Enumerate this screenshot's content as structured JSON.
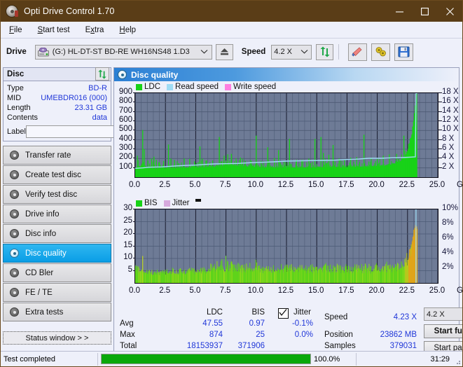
{
  "window": {
    "title": "Opti Drive Control 1.70",
    "icon": "disc-icon",
    "minimize": "minimize",
    "maximize": "maximize",
    "close": "close"
  },
  "menu": [
    {
      "label": "File",
      "accel": "F"
    },
    {
      "label": "Start test",
      "accel": "S"
    },
    {
      "label": "Extra",
      "accel": "x"
    },
    {
      "label": "Help",
      "accel": "H"
    }
  ],
  "toolbar": {
    "drive_label": "Drive",
    "drive_value": "(G:)  HL-DT-ST BD-RE  WH16NS48 1.D3",
    "eject_label": "eject",
    "speed_label": "Speed",
    "speed_value": "4.2 X",
    "refresh_label": "refresh",
    "erase_label": "erase",
    "bitsetting_label": "bitsetting",
    "save_label": "save"
  },
  "disc": {
    "header": "Disc",
    "refresh_label": "refresh",
    "rows": [
      {
        "key": "Type",
        "value": "BD-R"
      },
      {
        "key": "MID",
        "value": "UMEBDR016 (000)"
      },
      {
        "key": "Length",
        "value": "23.31 GB"
      },
      {
        "key": "Contents",
        "value": "data"
      }
    ],
    "label_key": "Label",
    "label_value": "",
    "label_placeholder": ""
  },
  "nav": {
    "items": [
      {
        "label": "Transfer rate",
        "selected": false
      },
      {
        "label": "Create test disc",
        "selected": false
      },
      {
        "label": "Verify test disc",
        "selected": false
      },
      {
        "label": "Drive info",
        "selected": false
      },
      {
        "label": "Disc info",
        "selected": false
      },
      {
        "label": "Disc quality",
        "selected": true
      },
      {
        "label": "CD Bler",
        "selected": false
      },
      {
        "label": "FE / TE",
        "selected": false
      },
      {
        "label": "Extra tests",
        "selected": false
      }
    ],
    "status_window": "Status window > >"
  },
  "panel": {
    "title": "Disc quality"
  },
  "stats": {
    "col_headers": [
      "LDC",
      "BIS"
    ],
    "jitter_label": "Jitter",
    "jitter_checked": true,
    "rows": [
      {
        "name": "Avg",
        "ldc": "47.55",
        "bis": "0.97",
        "jitter": "-0.1%"
      },
      {
        "name": "Max",
        "ldc": "874",
        "bis": "25",
        "jitter": "0.0%"
      },
      {
        "name": "Total",
        "ldc": "18153937",
        "bis": "371906",
        "jitter": ""
      }
    ],
    "speed_key": "Speed",
    "speed_value": "4.23 X",
    "position_key": "Position",
    "position_value": "23862 MB",
    "samples_key": "Samples",
    "samples_value": "379031",
    "speed_select": "4.2 X",
    "start_full": "Start full",
    "start_part": "Start part"
  },
  "statusbar": {
    "message": "Test completed",
    "progress_text": "100.0%",
    "progress_value": 100,
    "elapsed": "31:29"
  },
  "colors": {
    "ldc": "#18d218",
    "bis": "#5fd41a",
    "read_speed": "#9fdcf5",
    "write_speed": "#ff7fe0",
    "jitter": "#d7a9dd",
    "plot_bg": "#6e7b96",
    "accent": "#2037d8",
    "progress": "#0aa80a",
    "titlebar": "#5a3d17"
  },
  "chart_data": [
    {
      "type": "area",
      "id": "ldc-chart",
      "title": "Disc quality",
      "legend": [
        {
          "name": "LDC",
          "color": "#18d218"
        },
        {
          "name": "Read speed",
          "color": "#9fdcf5"
        },
        {
          "name": "Write speed",
          "color": "#ff7fe0"
        }
      ],
      "legend_position": "top-left",
      "grid": true,
      "xlabel": "GB",
      "xlim": [
        0,
        25
      ],
      "xticks": [
        "0.0",
        "2.5",
        "5.0",
        "7.5",
        "10.0",
        "12.5",
        "15.0",
        "17.5",
        "20.0",
        "22.5",
        "25.0"
      ],
      "ylabel": "",
      "ylim": [
        0,
        900
      ],
      "yticks": [
        100,
        200,
        300,
        400,
        500,
        600,
        700,
        800,
        900
      ],
      "y2label": "",
      "y2lim": [
        0,
        18
      ],
      "y2ticks": [
        "2 X",
        "4 X",
        "6 X",
        "8 X",
        "10 X",
        "12 X",
        "14 X",
        "16 X",
        "18 X"
      ],
      "data_end_gb": 23.31,
      "series": [
        {
          "name": "LDC",
          "color": "#18d218",
          "baseline": [
            [
              0.0,
              95
            ],
            [
              0.3,
              110
            ],
            [
              0.6,
              100
            ],
            [
              0.9,
              92
            ],
            [
              1.3,
              88
            ],
            [
              1.8,
              90
            ],
            [
              2.4,
              95
            ],
            [
              3.0,
              92
            ],
            [
              3.6,
              96
            ],
            [
              4.2,
              100
            ],
            [
              4.8,
              102
            ],
            [
              5.5,
              105
            ],
            [
              6.2,
              108
            ],
            [
              6.9,
              112
            ],
            [
              7.5,
              130
            ],
            [
              8.1,
              122
            ],
            [
              8.8,
              112
            ],
            [
              9.5,
              110
            ],
            [
              10.2,
              105
            ],
            [
              11.0,
              100
            ],
            [
              11.8,
              98
            ],
            [
              12.6,
              100
            ],
            [
              13.4,
              102
            ],
            [
              14.2,
              100
            ],
            [
              15.0,
              104
            ],
            [
              15.8,
              108
            ],
            [
              16.6,
              106
            ],
            [
              17.4,
              104
            ],
            [
              18.2,
              108
            ],
            [
              19.0,
              112
            ],
            [
              19.8,
              116
            ],
            [
              20.6,
              122
            ],
            [
              21.3,
              140
            ],
            [
              21.9,
              170
            ],
            [
              22.3,
              220
            ],
            [
              22.6,
              300
            ],
            [
              22.9,
              480
            ],
            [
              23.1,
              700
            ],
            [
              23.2,
              860
            ],
            [
              23.28,
              900
            ],
            [
              23.31,
              620
            ]
          ],
          "spikes": [
            [
              0.18,
              230
            ],
            [
              0.62,
              505
            ],
            [
              0.75,
              300
            ],
            [
              1.05,
              180
            ],
            [
              1.35,
              200
            ],
            [
              1.55,
              220
            ],
            [
              1.75,
              185
            ],
            [
              2.0,
              160
            ],
            [
              2.35,
              175
            ],
            [
              2.75,
              350
            ],
            [
              2.95,
              200
            ],
            [
              3.25,
              185
            ],
            [
              3.6,
              150
            ],
            [
              4.05,
              200
            ],
            [
              4.5,
              195
            ],
            [
              4.9,
              170
            ],
            [
              5.35,
              330
            ],
            [
              5.55,
              200
            ],
            [
              5.9,
              180
            ],
            [
              6.4,
              180
            ],
            [
              6.95,
              430
            ],
            [
              7.35,
              230
            ],
            [
              7.65,
              245
            ],
            [
              7.95,
              250
            ],
            [
              8.35,
              175
            ],
            [
              8.7,
              210
            ],
            [
              9.1,
              175
            ],
            [
              9.6,
              175
            ],
            [
              10.0,
              445
            ],
            [
              10.4,
              175
            ],
            [
              10.95,
              320
            ],
            [
              11.5,
              205
            ],
            [
              11.85,
              290
            ],
            [
              12.3,
              175
            ],
            [
              12.75,
              410
            ],
            [
              13.3,
              180
            ],
            [
              13.85,
              185
            ],
            [
              14.35,
              200
            ],
            [
              14.85,
              410
            ],
            [
              15.35,
              430
            ],
            [
              15.55,
              260
            ],
            [
              16.0,
              240
            ],
            [
              16.35,
              345
            ],
            [
              16.85,
              200
            ],
            [
              17.3,
              190
            ],
            [
              17.8,
              210
            ],
            [
              18.3,
              215
            ],
            [
              18.9,
              455
            ],
            [
              19.5,
              210
            ],
            [
              20.0,
              195
            ],
            [
              20.5,
              230
            ],
            [
              21.0,
              245
            ],
            [
              21.6,
              250
            ],
            [
              22.2,
              445
            ],
            [
              22.55,
              300
            ]
          ]
        },
        {
          "name": "Read speed",
          "color": "#9fdcf5",
          "axis": "right",
          "points": [
            [
              0.0,
              1.9
            ],
            [
              0.6,
              2.0
            ],
            [
              1.2,
              2.15
            ],
            [
              2.2,
              2.2
            ],
            [
              3.0,
              2.35
            ],
            [
              4.0,
              2.5
            ],
            [
              5.0,
              2.6
            ],
            [
              5.8,
              2.75
            ],
            [
              6.6,
              2.85
            ],
            [
              7.5,
              2.9
            ],
            [
              8.5,
              2.95
            ],
            [
              9.5,
              3.1
            ],
            [
              10.5,
              3.2
            ],
            [
              11.5,
              3.3
            ],
            [
              12.5,
              3.45
            ],
            [
              13.5,
              3.5
            ],
            [
              14.5,
              3.55
            ],
            [
              15.5,
              3.6
            ],
            [
              16.5,
              3.65
            ],
            [
              17.5,
              3.8
            ],
            [
              18.5,
              3.9
            ],
            [
              19.3,
              4.05
            ],
            [
              20.3,
              4.05
            ],
            [
              21.2,
              4.15
            ],
            [
              22.0,
              4.2
            ],
            [
              22.8,
              4.3
            ],
            [
              23.15,
              4.35
            ],
            [
              23.2,
              18.0
            ],
            [
              23.3,
              18.0
            ]
          ]
        },
        {
          "name": "Write speed",
          "color": "#ff7fe0",
          "points": []
        }
      ]
    },
    {
      "type": "area",
      "id": "bis-chart",
      "legend": [
        {
          "name": "BIS",
          "color": "#18d218"
        },
        {
          "name": "Jitter",
          "color": "#d7a9dd"
        }
      ],
      "legend_position": "top-left",
      "grid": true,
      "xlabel": "GB",
      "xlim": [
        0,
        25
      ],
      "xticks": [
        "0.0",
        "2.5",
        "5.0",
        "7.5",
        "10.0",
        "12.5",
        "15.0",
        "17.5",
        "20.0",
        "22.5",
        "25.0"
      ],
      "ylim": [
        0,
        30
      ],
      "yticks": [
        5,
        10,
        15,
        20,
        25,
        30
      ],
      "y2lim": [
        0,
        10
      ],
      "y2ticks": [
        "2%",
        "4%",
        "6%",
        "8%",
        "10%"
      ],
      "data_end_gb": 23.31,
      "series": [
        {
          "name": "BIS",
          "color": "#5fd41a",
          "noise_band": [
            [
              0.0,
              4.5,
              8.5
            ],
            [
              1.0,
              3.0,
              5.5
            ],
            [
              2.0,
              3.0,
              6.0
            ],
            [
              3.0,
              3.2,
              6.5
            ],
            [
              4.0,
              3.2,
              7.0
            ],
            [
              5.0,
              3.3,
              7.0
            ],
            [
              6.0,
              3.5,
              7.5
            ],
            [
              7.0,
              4.0,
              11.0
            ],
            [
              7.5,
              4.2,
              12.0
            ],
            [
              8.0,
              4.0,
              9.5
            ],
            [
              9.0,
              4.0,
              9.5
            ],
            [
              10.0,
              4.0,
              10.5
            ],
            [
              11.0,
              3.8,
              8.0
            ],
            [
              12.0,
              3.8,
              8.0
            ],
            [
              13.0,
              3.8,
              8.5
            ],
            [
              14.0,
              3.8,
              8.0
            ],
            [
              15.0,
              3.8,
              9.0
            ],
            [
              16.0,
              3.8,
              8.5
            ],
            [
              17.0,
              3.8,
              8.0
            ],
            [
              18.0,
              3.8,
              8.5
            ],
            [
              19.0,
              3.8,
              9.5
            ],
            [
              20.0,
              3.8,
              8.5
            ],
            [
              21.0,
              4.0,
              9.0
            ],
            [
              22.0,
              4.5,
              10.0
            ],
            [
              22.5,
              6.0,
              13.0
            ],
            [
              22.8,
              10.0,
              18.0
            ],
            [
              23.0,
              14.0,
              22.0
            ],
            [
              23.15,
              18.0,
              24.0
            ],
            [
              23.28,
              20.0,
              24.5
            ]
          ],
          "max_spike": [
            0.62,
            11.0
          ]
        },
        {
          "name": "Jitter",
          "color": "#d7a9dd",
          "points": []
        },
        {
          "name": "Read speed marker",
          "color": "#9fdcf5",
          "points": [
            [
              23.2,
              30.0
            ]
          ]
        }
      ]
    }
  ]
}
